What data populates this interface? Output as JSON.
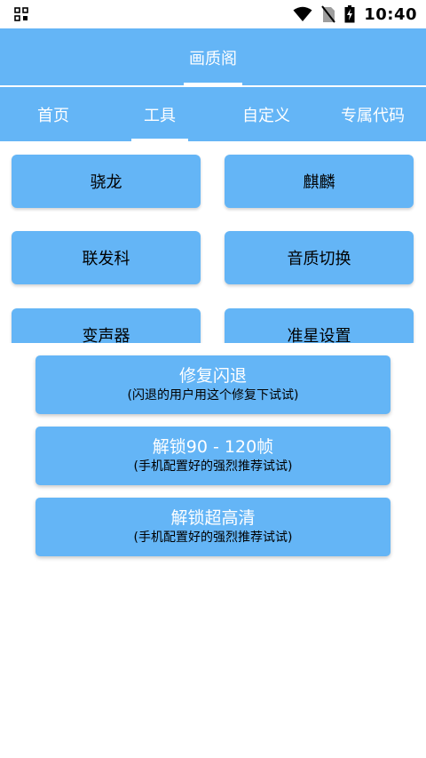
{
  "status_bar": {
    "time": "10:40",
    "icons": [
      "grid-notification-icon",
      "wifi-icon",
      "no-sim-icon",
      "battery-charging-icon"
    ]
  },
  "app_bar": {
    "title": "画质阁"
  },
  "tabs": [
    {
      "label": "首页",
      "active": false
    },
    {
      "label": "工具",
      "active": true
    },
    {
      "label": "自定义",
      "active": false
    },
    {
      "label": "专属代码",
      "active": false
    }
  ],
  "tool_buttons": [
    {
      "label": "骁龙"
    },
    {
      "label": "麒麟"
    },
    {
      "label": "联发科"
    },
    {
      "label": "音质切换"
    },
    {
      "label": "变声器"
    },
    {
      "label": "准星设置"
    }
  ],
  "action_buttons": [
    {
      "title": "修复闪退",
      "subtitle": "(闪退的用户用这个修复下试试)"
    },
    {
      "title": "解锁90 - 120帧",
      "subtitle": "(手机配置好的强烈推荐试试)"
    },
    {
      "title": "解锁超高清",
      "subtitle": "(手机配置好的强烈推荐试试)"
    }
  ],
  "colors": {
    "primary": "#64b5f6",
    "text_on_primary": "#ffffff"
  }
}
